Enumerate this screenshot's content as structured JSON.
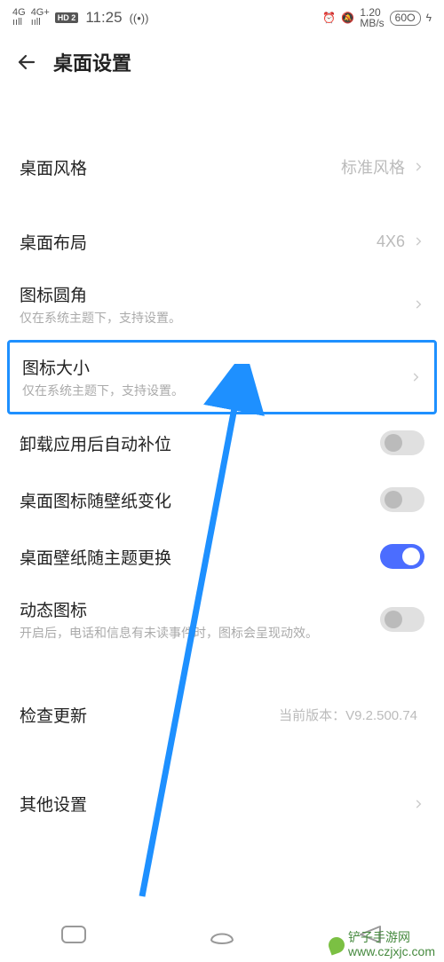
{
  "status": {
    "left_signal1": "4G",
    "left_signal2": "4G+",
    "hd_badge": "HD 2",
    "time": "11:25",
    "wifi_icon": "((•))",
    "speed_top": "1.20",
    "speed_unit": "MB/s",
    "battery": "60"
  },
  "header": {
    "title": "桌面设置"
  },
  "rows": {
    "style": {
      "title": "桌面风格",
      "value": "标准风格"
    },
    "layout": {
      "title": "桌面布局",
      "value": "4X6"
    },
    "icon_corner": {
      "title": "图标圆角",
      "subtitle": "仅在系统主题下，支持设置。"
    },
    "icon_size": {
      "title": "图标大小",
      "subtitle": "仅在系统主题下，支持设置。"
    },
    "auto_fill": {
      "title": "卸载应用后自动补位"
    },
    "icon_with_wallpaper": {
      "title": "桌面图标随壁纸变化"
    },
    "wallpaper_with_theme": {
      "title": "桌面壁纸随主题更换"
    },
    "dynamic_icon": {
      "title": "动态图标",
      "subtitle": "开启后，电话和信息有未读事件时，图标会呈现动效。"
    },
    "check_update": {
      "title": "检查更新",
      "value": "当前版本：V9.2.500.74"
    },
    "other": {
      "title": "其他设置"
    }
  },
  "watermark": "铲子手游网\nwww.czjxjc.com"
}
